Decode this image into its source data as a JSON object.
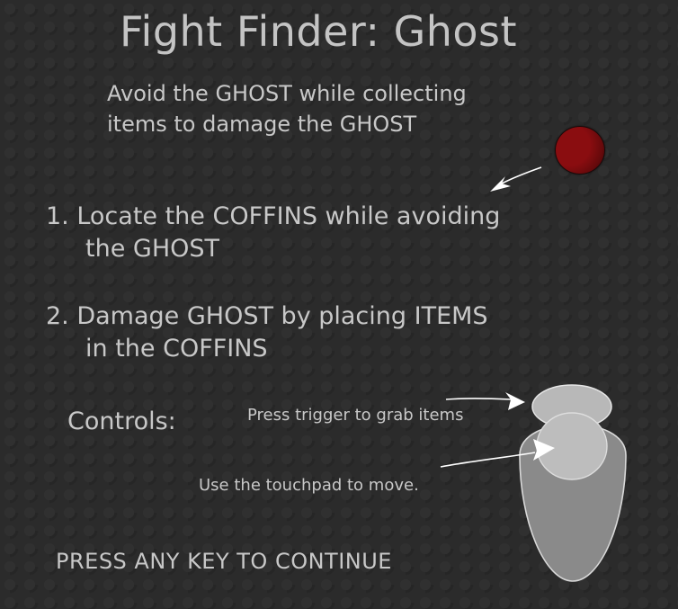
{
  "title": "Fight Finder: Ghost",
  "intro": {
    "line1": "Avoid the GHOST while collecting",
    "line2": "items to damage the GHOST"
  },
  "steps": [
    {
      "line1": "1. Locate the COFFINS while avoiding",
      "line2": "the GHOST"
    },
    {
      "line1": "2. Damage GHOST by placing ITEMS",
      "line2": "in the COFFINS"
    }
  ],
  "controls": {
    "label": "Controls:",
    "trigger_hint": "Press trigger to grab items",
    "touchpad_hint": "Use the touchpad to move."
  },
  "continue_prompt": "PRESS ANY KEY TO CONTINUE",
  "colors": {
    "background": "#2b2b2b",
    "text": "#c8c8c8",
    "ghost_orb": "#8a0d10",
    "controller": "#8c8c8c",
    "arrow": "#ffffff"
  },
  "icons": {
    "ghost": "red-orb",
    "controller": "vr-controller-icon",
    "pointers": "arrow-icon"
  }
}
